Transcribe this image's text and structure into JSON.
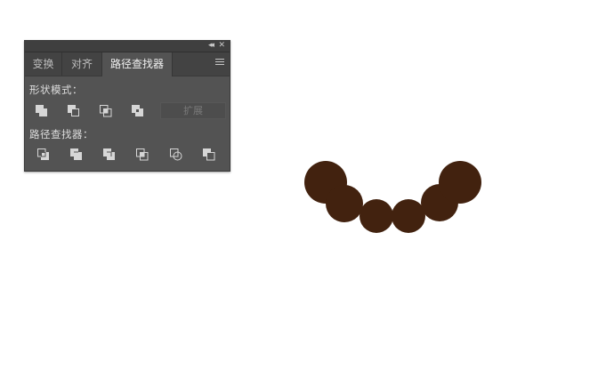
{
  "panel": {
    "tabs": [
      {
        "label": "变换"
      },
      {
        "label": "对齐"
      },
      {
        "label": "路径查找器"
      }
    ],
    "active_tab": "路径查找器",
    "shape_modes_label": "形状模式：",
    "pathfinders_label": "路径查找器：",
    "expand_label": "扩展",
    "shape_mode_icons": [
      "unite-icon",
      "minus-front-icon",
      "intersect-icon",
      "exclude-icon"
    ],
    "pathfinder_icons": [
      "divide-icon",
      "trim-icon",
      "merge-icon",
      "crop-icon",
      "outline-icon",
      "minus-back-icon"
    ],
    "titlebar_icons": [
      "collapse-icon",
      "close-icon"
    ]
  },
  "artwork": {
    "shape_count": 6,
    "fill_color": "#42220f"
  },
  "colors": {
    "panel_bg": "#535353",
    "tab_bar_bg": "#434343",
    "icon_color": "#d6d6d6",
    "canvas_bg": "#ffffff"
  }
}
